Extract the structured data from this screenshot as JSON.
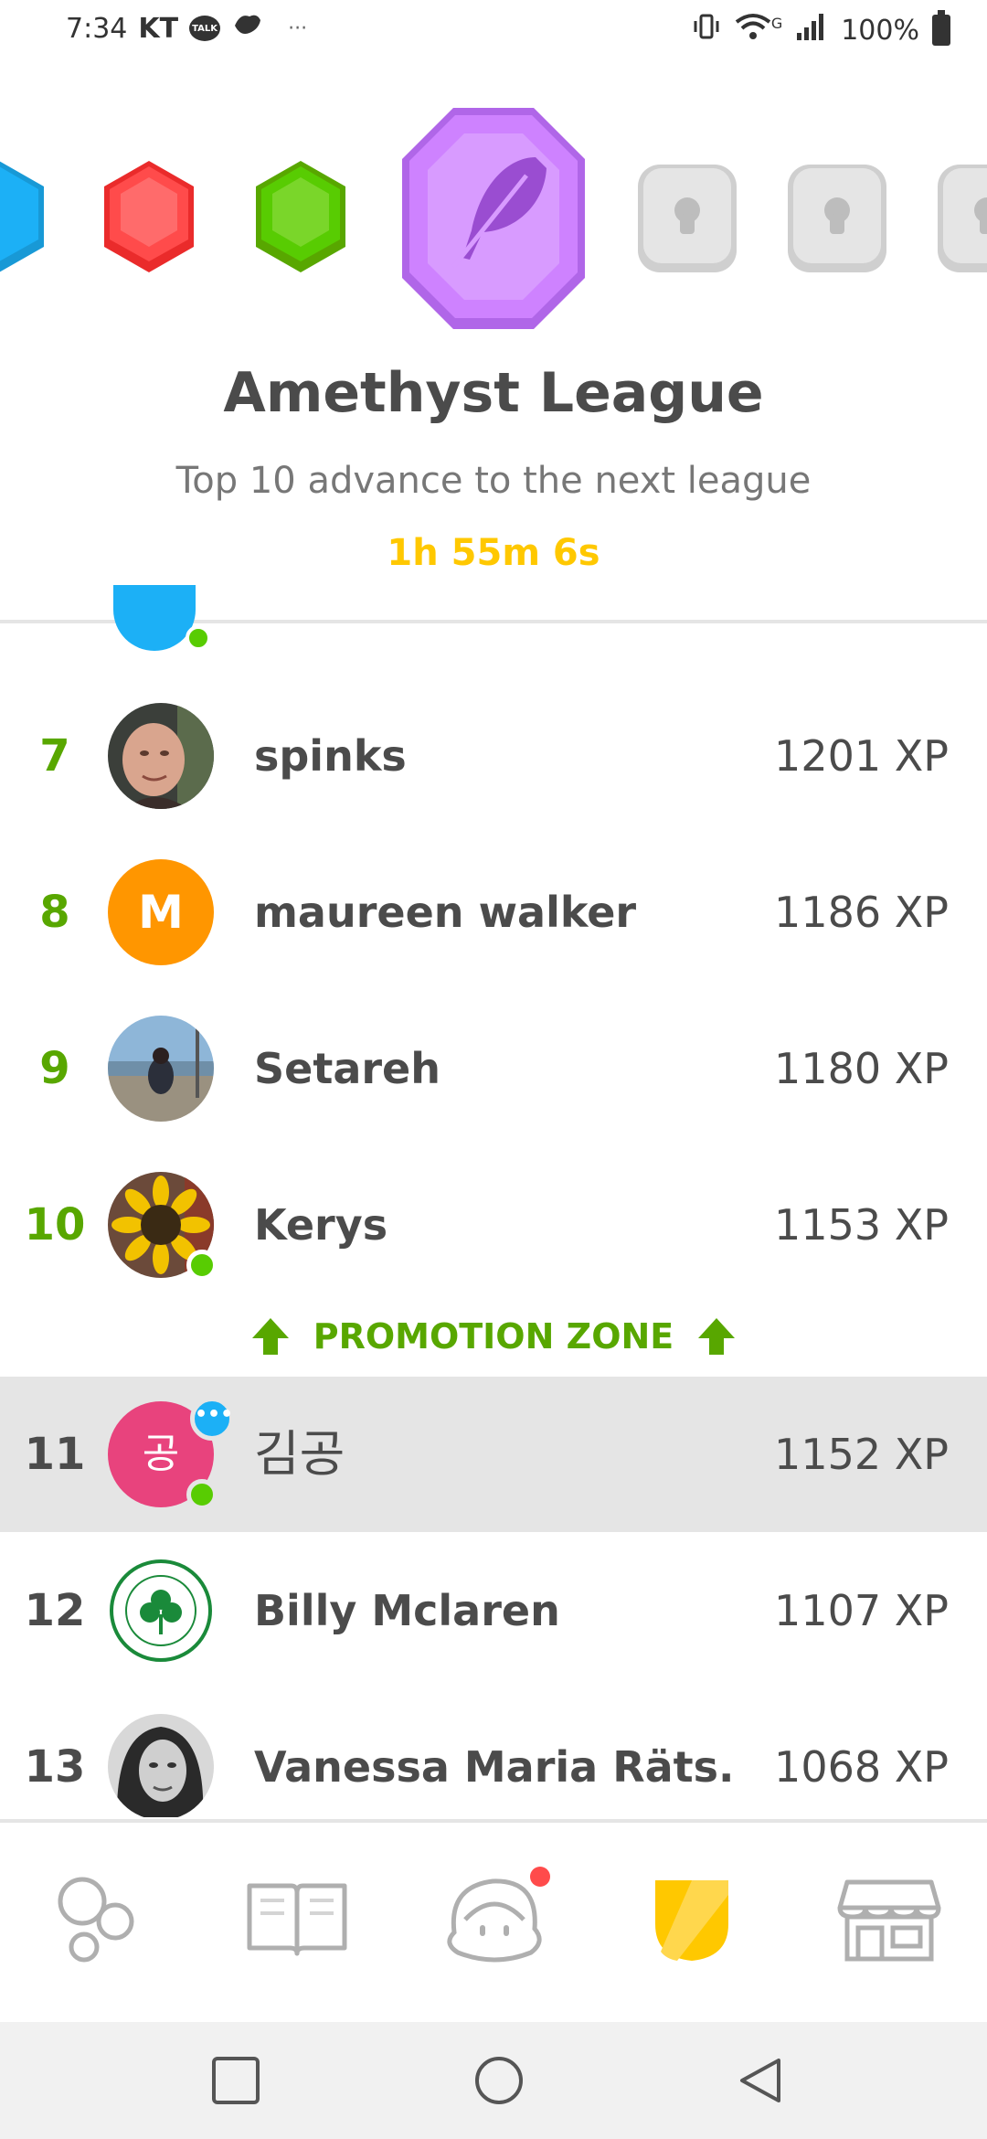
{
  "status_bar": {
    "time": "7:34",
    "carrier": "KT",
    "talk_label": "TALK",
    "overflow": "···",
    "battery": "100%",
    "network": "G"
  },
  "league": {
    "title": "Amethyst League",
    "subtitle": "Top 10 advance to the next league",
    "timer": "1h 55m 6s",
    "badge_colors": [
      "#1cb0f6",
      "#ff4b4b",
      "#58cc02",
      "#ce82ff",
      "#e5e5e5",
      "#e5e5e5",
      "#e5e5e5"
    ]
  },
  "leaderboard": [
    {
      "rank": "7",
      "name": "spinks",
      "xp": "1201 XP",
      "avatar": "photo-man",
      "online": false
    },
    {
      "rank": "8",
      "name": "maureen walker",
      "xp": "1186 XP",
      "avatar_letter": "M",
      "online": false
    },
    {
      "rank": "9",
      "name": "Setareh",
      "xp": "1180 XP",
      "avatar": "photo-beach",
      "online": false
    },
    {
      "rank": "10",
      "name": "Kerys",
      "xp": "1153 XP",
      "avatar": "photo-sunflower",
      "online": true
    },
    {
      "rank": "11",
      "name": "김공",
      "xp": "1152 XP",
      "avatar_letter": "공",
      "online": true,
      "is_current_user": true
    },
    {
      "rank": "12",
      "name": "Billy Mclaren",
      "xp": "1107 XP",
      "avatar": "celtic-crest",
      "online": false
    },
    {
      "rank": "13",
      "name": "Vanessa Maria Räts...",
      "xp": "1068 XP",
      "avatar": "photo-woman",
      "online": false
    }
  ],
  "promotion_zone": {
    "label": "PROMOTION ZONE"
  },
  "chat_indicator": "•••",
  "tabs": [
    {
      "name": "learn",
      "icon": "circles-icon"
    },
    {
      "name": "stories",
      "icon": "book-icon"
    },
    {
      "name": "profile",
      "icon": "face-icon",
      "has_notification": true
    },
    {
      "name": "leaderboards",
      "icon": "shield-icon",
      "active": true
    },
    {
      "name": "shop",
      "icon": "shop-icon"
    }
  ],
  "colors": {
    "green": "#58a700",
    "online": "#58cc02",
    "timer": "#ffc800",
    "amethyst": "#ce82ff"
  }
}
